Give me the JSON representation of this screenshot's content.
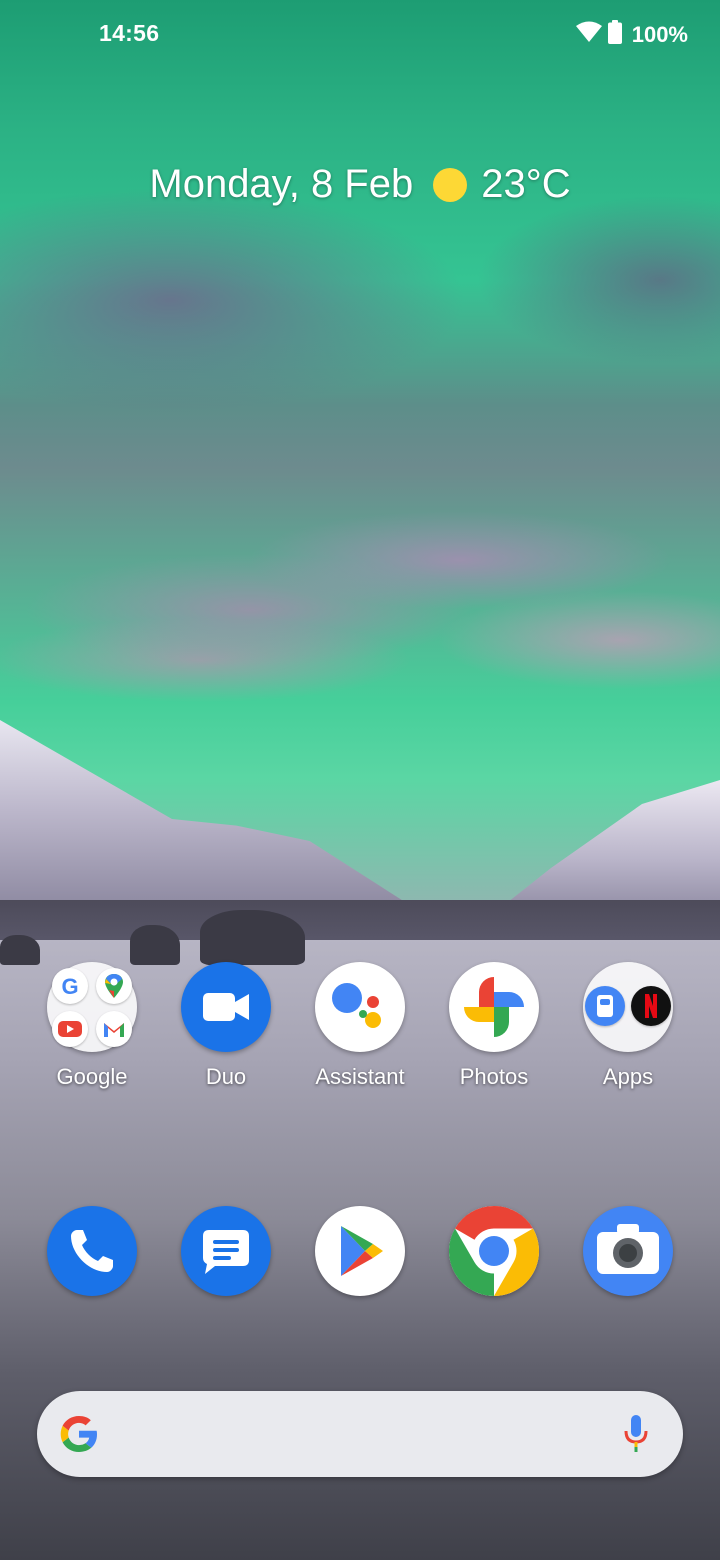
{
  "status_bar": {
    "time": "14:56",
    "battery_percent": "100%",
    "icons": [
      "wifi-icon",
      "battery-icon"
    ]
  },
  "at_a_glance": {
    "date": "Monday, 8 Feb",
    "temperature": "23°C",
    "weather_icon": "sun-icon"
  },
  "home_row": [
    {
      "label": "Google",
      "icon": "google-folder-icon"
    },
    {
      "label": "Duo",
      "icon": "duo-icon"
    },
    {
      "label": "Assistant",
      "icon": "assistant-icon"
    },
    {
      "label": "Photos",
      "icon": "photos-icon"
    },
    {
      "label": "Apps",
      "icon": "apps-folder-icon"
    }
  ],
  "dock": [
    {
      "name": "Phone",
      "icon": "phone-icon"
    },
    {
      "name": "Messages",
      "icon": "messages-icon"
    },
    {
      "name": "Play Store",
      "icon": "play-store-icon"
    },
    {
      "name": "Chrome",
      "icon": "chrome-icon"
    },
    {
      "name": "Camera",
      "icon": "camera-icon"
    }
  ],
  "search_bar": {
    "left_icon": "google-g-icon",
    "right_icon": "mic-icon"
  },
  "colors": {
    "google_blue": "#4285F4",
    "google_red": "#EA4335",
    "google_yellow": "#FBBC05",
    "google_green": "#34A853",
    "duo_blue": "#1a73e8"
  }
}
